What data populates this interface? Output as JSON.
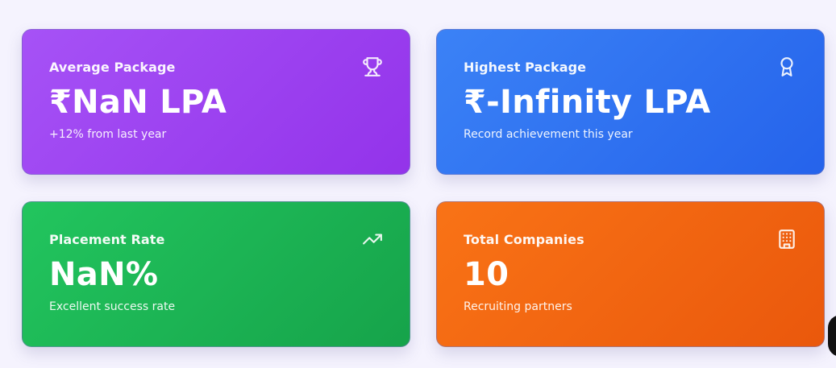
{
  "cards": [
    {
      "label": "Average Package",
      "value": "₹NaN LPA",
      "subtitle": "+12% from last year",
      "icon": "trophy-icon",
      "color": "#9333ea"
    },
    {
      "label": "Highest Package",
      "value": "₹-Infinity LPA",
      "subtitle": "Record achievement this year",
      "icon": "award-icon",
      "color": "#2563eb"
    },
    {
      "label": "Placement Rate",
      "value": "NaN%",
      "subtitle": "Excellent success rate",
      "icon": "trending-up-icon",
      "color": "#16a34a"
    },
    {
      "label": "Total Companies",
      "value": "10",
      "subtitle": "Recruiting partners",
      "icon": "building-icon",
      "color": "#ea580c"
    }
  ]
}
